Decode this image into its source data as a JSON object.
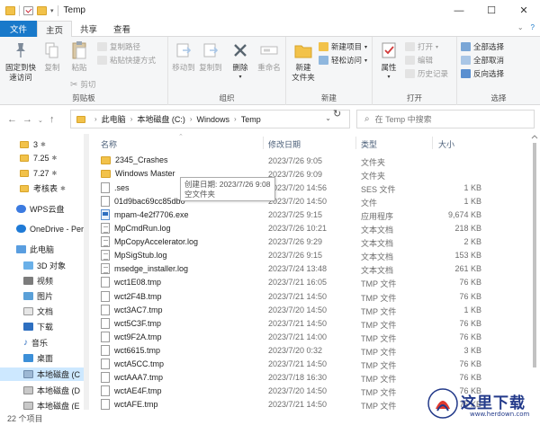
{
  "window": {
    "title": "Temp",
    "min": "—",
    "max": "☐",
    "close": "✕"
  },
  "ribbon_tabs": [
    "文件",
    "主页",
    "共享",
    "查看"
  ],
  "ribbon": {
    "clipboard": {
      "pin_quick_access": "固定到快\n速访问",
      "copy": "复制",
      "paste": "粘贴",
      "copy_path": "复制路径",
      "paste_shortcut": "粘贴快捷方式",
      "cut": "剪切",
      "label": "剪贴板"
    },
    "organize": {
      "move_to": "移动到",
      "copy_to": "复制到",
      "delete": "删除",
      "rename": "重命名",
      "label": "组织"
    },
    "new": {
      "new_folder": "新建\n文件夹",
      "new_item": "新建项目",
      "easy_access": "轻松访问",
      "label": "新建"
    },
    "open": {
      "properties": "属性",
      "open": "打开",
      "edit": "编辑",
      "history": "历史记录",
      "label": "打开"
    },
    "select": {
      "select_all": "全部选择",
      "select_none": "全部取消",
      "invert": "反向选择",
      "label": "选择"
    }
  },
  "address": {
    "crumbs": [
      "此电脑",
      "本地磁盘 (C:)",
      "Windows",
      "Temp"
    ],
    "search_placeholder": "在 Temp 中搜索"
  },
  "nav_pane": [
    {
      "label": "3",
      "kind": "folder",
      "pinned": true
    },
    {
      "label": "7.25",
      "kind": "folder",
      "pinned": true
    },
    {
      "label": "7.27",
      "kind": "folder",
      "pinned": true
    },
    {
      "label": "考核表",
      "kind": "folder",
      "pinned": true
    },
    {
      "label": "WPS云盘",
      "kind": "cloud"
    },
    {
      "label": "OneDrive - Pers",
      "kind": "onedrive"
    },
    {
      "label": "此电脑",
      "kind": "pc"
    },
    {
      "label": "3D 对象",
      "kind": "3d"
    },
    {
      "label": "视频",
      "kind": "video"
    },
    {
      "label": "图片",
      "kind": "pictures"
    },
    {
      "label": "文档",
      "kind": "docs"
    },
    {
      "label": "下载",
      "kind": "download"
    },
    {
      "label": "音乐",
      "kind": "music"
    },
    {
      "label": "桌面",
      "kind": "desktop"
    },
    {
      "label": "本地磁盘 (C",
      "kind": "drive",
      "selected": true
    },
    {
      "label": "本地磁盘 (D",
      "kind": "drive"
    },
    {
      "label": "本地磁盘 (E",
      "kind": "drive"
    }
  ],
  "columns": {
    "name": "名称",
    "date": "修改日期",
    "type": "类型",
    "size": "大小"
  },
  "files": [
    {
      "name": "2345_Crashes",
      "date": "2023/7/26 9:05",
      "type": "文件夹",
      "size": "",
      "icon": "folder"
    },
    {
      "name": "Windows Master",
      "date": "2023/7/26 9:09",
      "type": "文件夹",
      "size": "",
      "icon": "folder"
    },
    {
      "name": ".ses",
      "date": "2023/7/20 14:56",
      "type": "SES 文件",
      "size": "1 KB",
      "icon": "file"
    },
    {
      "name": "01d9bac69cc85db0",
      "date": "2023/7/20 14:50",
      "type": "文件",
      "size": "1 KB",
      "icon": "file"
    },
    {
      "name": "mpam-4e2f7706.exe",
      "date": "2023/7/25 9:15",
      "type": "应用程序",
      "size": "9,674 KB",
      "icon": "exe"
    },
    {
      "name": "MpCmdRun.log",
      "date": "2023/7/26 10:21",
      "type": "文本文档",
      "size": "218 KB",
      "icon": "txt"
    },
    {
      "name": "MpCopyAccelerator.log",
      "date": "2023/7/26 9:29",
      "type": "文本文档",
      "size": "2 KB",
      "icon": "txt"
    },
    {
      "name": "MpSigStub.log",
      "date": "2023/7/26 9:15",
      "type": "文本文档",
      "size": "153 KB",
      "icon": "txt"
    },
    {
      "name": "msedge_installer.log",
      "date": "2023/7/24 13:48",
      "type": "文本文档",
      "size": "261 KB",
      "icon": "txt"
    },
    {
      "name": "wct1E08.tmp",
      "date": "2023/7/21 16:05",
      "type": "TMP 文件",
      "size": "76 KB",
      "icon": "file"
    },
    {
      "name": "wct2F4B.tmp",
      "date": "2023/7/21 14:50",
      "type": "TMP 文件",
      "size": "76 KB",
      "icon": "file"
    },
    {
      "name": "wct3AC7.tmp",
      "date": "2023/7/20 14:50",
      "type": "TMP 文件",
      "size": "1 KB",
      "icon": "file"
    },
    {
      "name": "wct5C3F.tmp",
      "date": "2023/7/21 14:50",
      "type": "TMP 文件",
      "size": "76 KB",
      "icon": "file"
    },
    {
      "name": "wct9F2A.tmp",
      "date": "2023/7/21 14:00",
      "type": "TMP 文件",
      "size": "76 KB",
      "icon": "file"
    },
    {
      "name": "wct6615.tmp",
      "date": "2023/7/20 0:32",
      "type": "TMP 文件",
      "size": "3 KB",
      "icon": "file"
    },
    {
      "name": "wctA5CC.tmp",
      "date": "2023/7/21 14:50",
      "type": "TMP 文件",
      "size": "76 KB",
      "icon": "file"
    },
    {
      "name": "wctAAA7.tmp",
      "date": "2023/7/18 16:30",
      "type": "TMP 文件",
      "size": "76 KB",
      "icon": "file"
    },
    {
      "name": "wctAE4F.tmp",
      "date": "2023/7/20 14:50",
      "type": "TMP 文件",
      "size": "76 KB",
      "icon": "file"
    },
    {
      "name": "wctAFE.tmp",
      "date": "2023/7/21 14:50",
      "type": "TMP 文件",
      "size": "76 KB",
      "icon": "file"
    }
  ],
  "tooltip": {
    "line1": "创建日期: 2023/7/26 9:08",
    "line2": "空文件夹"
  },
  "status": {
    "count": "22 个项目"
  },
  "watermark": {
    "text": "这里下载",
    "url": "www.herdown.com"
  },
  "colors": {
    "accent": "#1979ca",
    "folder": "#f2c24a",
    "selection": "#cde8ff"
  }
}
